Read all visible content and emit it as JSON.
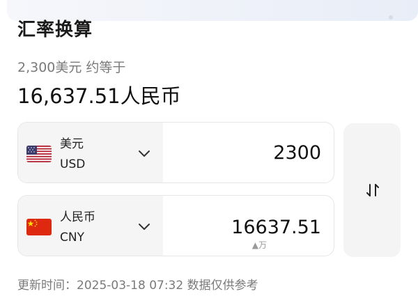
{
  "header": {
    "title": "汇率换算"
  },
  "summary": {
    "from_text": "2,300美元 约等于",
    "to_text": "16,637.51人民币"
  },
  "rows": [
    {
      "currency_name": "美元",
      "currency_code": "USD",
      "flag_icon": "us-flag-icon",
      "amount": "2300"
    },
    {
      "currency_name": "人民币",
      "currency_code": "CNY",
      "flag_icon": "cn-flag-icon",
      "amount": "16637.51",
      "unit_hint": "▲万"
    }
  ],
  "swap": {
    "icon": "swap-vertical-icon"
  },
  "footer": {
    "update_text": "更新时间：2025-03-18 07:32 数据仅供参考"
  },
  "colors": {
    "selector_bg": "#f5f5f5",
    "secondary_text": "#7a7a7a",
    "us_red": "#b22234",
    "us_blue": "#3c3b6e",
    "cn_red": "#de2910",
    "cn_yellow": "#ffde00"
  }
}
